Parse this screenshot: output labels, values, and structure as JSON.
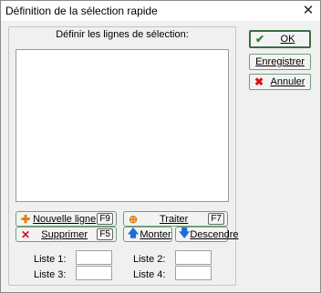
{
  "window": {
    "title": "Définition de la sélection rapide"
  },
  "group": {
    "label": "Définir les lignes de sélection:"
  },
  "buttons": {
    "new_line": {
      "label": "Nouvelle ligne",
      "key": "F9"
    },
    "process": {
      "label": "Traiter",
      "key": "F7"
    },
    "delete": {
      "label": "Supprimer",
      "key": "F5"
    },
    "up": {
      "label": "Monter"
    },
    "down": {
      "label": "Descendre"
    }
  },
  "side": {
    "ok": "OK",
    "save": "Enregistrer",
    "cancel": "Annuler"
  },
  "lists": {
    "l1": {
      "label": "Liste 1:",
      "value": ""
    },
    "l2": {
      "label": "Liste 2:",
      "value": ""
    },
    "l3": {
      "label": "Liste 3:",
      "value": ""
    },
    "l4": {
      "label": "Liste 4:",
      "value": ""
    }
  },
  "icons": {
    "close": "close-icon",
    "ok": "checkmark-icon",
    "cancel": "cross-icon",
    "new_line": "plus-icon",
    "process": "process-icon",
    "delete": "cross-icon",
    "up": "arrow-up-icon",
    "down": "arrow-down-icon"
  }
}
